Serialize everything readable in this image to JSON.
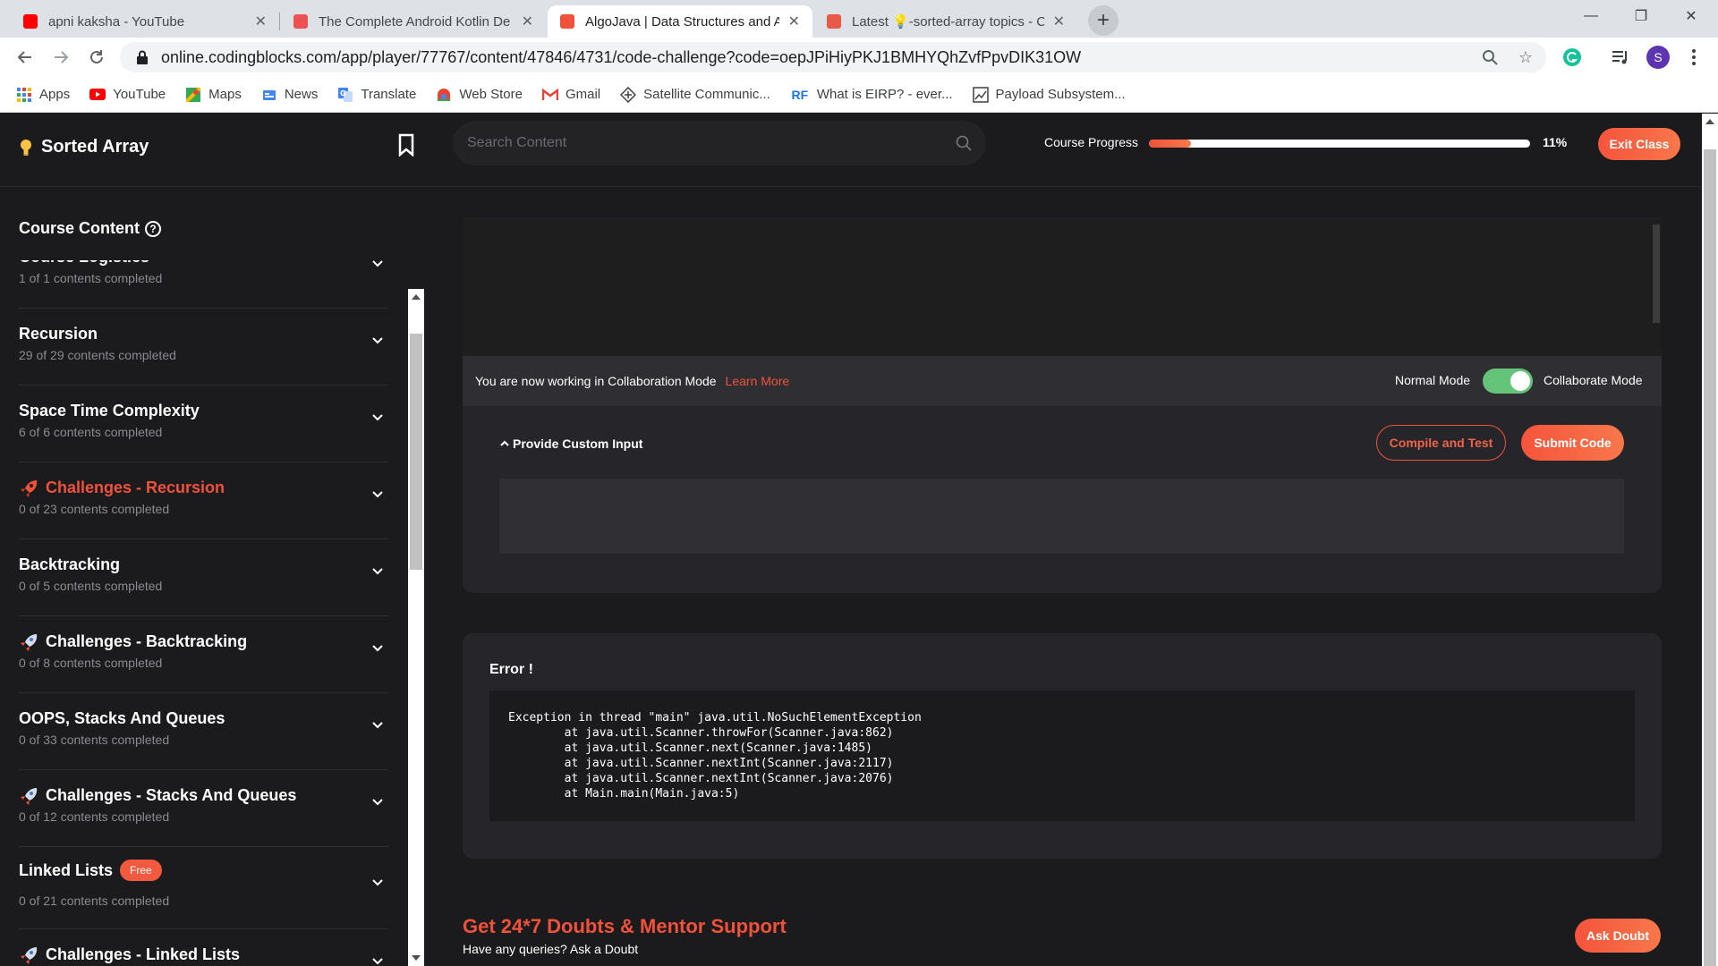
{
  "browser": {
    "tabs": [
      {
        "title": "apni kaksha - YouTube",
        "favicon_color": "#ff0000",
        "active": false
      },
      {
        "title": "The Complete Android Kotlin De",
        "favicon_color": "#ec5252",
        "active": false
      },
      {
        "title": "AlgoJava | Data Structures and A",
        "favicon_color": "#f0513a",
        "active": true
      },
      {
        "title": "Latest 💡-sorted-array topics - C",
        "favicon_color": "#e8594a",
        "active": false
      }
    ],
    "new_tab_icon": "plus-icon",
    "window_controls": {
      "minimize": "—",
      "restore": "❐",
      "close": "✕"
    },
    "url": "online.codingblocks.com/app/player/77767/content/47846/4731/code-challenge?code=oepJPiHiyPKJ1BMHYQhZvfPpvDIK31OW",
    "profile_initial": "S",
    "bookmarks": [
      {
        "label": "Apps",
        "icon": "apps-grid-icon"
      },
      {
        "label": "YouTube",
        "icon": "youtube-icon"
      },
      {
        "label": "Maps",
        "icon": "maps-icon"
      },
      {
        "label": "News",
        "icon": "news-icon"
      },
      {
        "label": "Translate",
        "icon": "translate-icon"
      },
      {
        "label": "Web Store",
        "icon": "webstore-icon"
      },
      {
        "label": "Gmail",
        "icon": "gmail-icon"
      },
      {
        "label": "Satellite Communic...",
        "icon": "satellite-icon"
      },
      {
        "label": "What is EIRP? - ever...",
        "icon": "rf-icon"
      },
      {
        "label": "Payload Subsystem...",
        "icon": "chart-icon"
      }
    ]
  },
  "header": {
    "title": "Sorted Array",
    "search_placeholder": "Search Content",
    "progress_label": "Course Progress",
    "progress_percent_text": "11%",
    "progress_value": 0.11,
    "exit_label": "Exit Class"
  },
  "sidebar": {
    "title": "Course Content",
    "sections": [
      {
        "name": "Course Logistics",
        "progress": "1 of 1 contents completed",
        "style": "normal",
        "badge": ""
      },
      {
        "name": "Recursion",
        "progress": "29 of 29 contents completed",
        "style": "normal",
        "badge": ""
      },
      {
        "name": "Space Time Complexity",
        "progress": "6 of 6 contents completed",
        "style": "normal",
        "badge": ""
      },
      {
        "name": "Challenges - Recursion",
        "progress": "0 of 23 contents completed",
        "style": "accent",
        "badge": ""
      },
      {
        "name": "Backtracking",
        "progress": "0 of 5 contents completed",
        "style": "normal",
        "badge": ""
      },
      {
        "name": "Challenges - Backtracking",
        "progress": "0 of 8 contents completed",
        "style": "rocket",
        "badge": ""
      },
      {
        "name": "OOPS, Stacks And Queues",
        "progress": "0 of 33 contents completed",
        "style": "normal",
        "badge": ""
      },
      {
        "name": "Challenges - Stacks And Queues",
        "progress": "0 of 12 contents completed",
        "style": "rocket",
        "badge": ""
      },
      {
        "name": "Linked Lists",
        "progress": "0 of 21 contents completed",
        "style": "normal",
        "badge": "Free"
      },
      {
        "name": "Challenges - Linked Lists",
        "progress": "",
        "style": "rocket",
        "badge": ""
      }
    ]
  },
  "editor": {
    "collab_message": "You are now working in Collaboration Mode",
    "learn_more": "Learn More",
    "normal_mode": "Normal Mode",
    "collab_mode": "Collaborate Mode",
    "collab_enabled": true,
    "custom_input_label": "Provide Custom Input",
    "compile_label": "Compile and Test",
    "submit_label": "Submit Code"
  },
  "error": {
    "title": "Error !",
    "lines": [
      "Exception in thread \"main\" java.util.NoSuchElementException",
      "        at java.util.Scanner.throwFor(Scanner.java:862)",
      "        at java.util.Scanner.next(Scanner.java:1485)",
      "        at java.util.Scanner.nextInt(Scanner.java:2117)",
      "        at java.util.Scanner.nextInt(Scanner.java:2076)",
      "        at Main.main(Main.java:5)"
    ]
  },
  "doubt": {
    "title": "Get 24*7 Doubts & Mentor Support",
    "subtitle": "Have any queries? Ask a Doubt",
    "ask_label": "Ask Doubt"
  },
  "colors": {
    "accent": "#f0513a",
    "background": "#1b1b1d",
    "panel": "#26262a",
    "toggle_on": "#64c47a"
  }
}
